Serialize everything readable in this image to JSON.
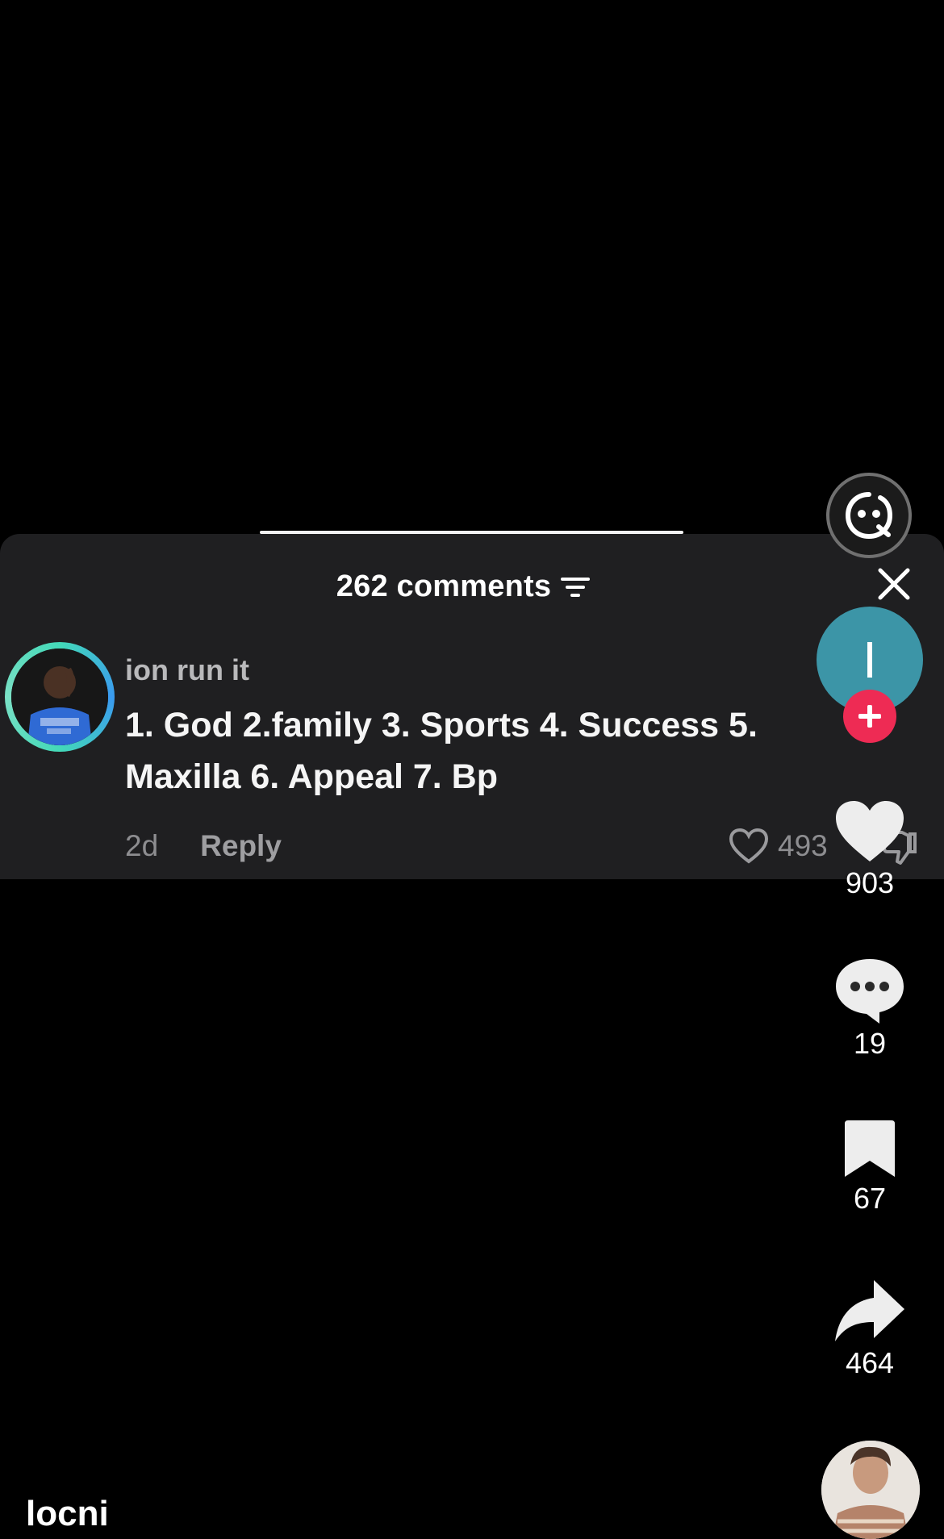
{
  "comments_panel": {
    "count_label": "262 comments",
    "comment": {
      "username": "ion run it",
      "text": "1. God 2.family 3. Sports 4. Success 5. Maxilla 6. Appeal 7. Bp",
      "age": "2d",
      "reply_label": "Reply",
      "like_count": "493"
    }
  },
  "actions": {
    "likes": "903",
    "comments": "19",
    "saves": "67",
    "shares": "464"
  },
  "creator": {
    "avatar_initial": "I"
  },
  "author": {
    "name": "locni"
  },
  "colors": {
    "follow_plus": "#ee2b54",
    "creator_avatar_bg": "#3c95a7",
    "panel_bg": "#1f1f21"
  }
}
